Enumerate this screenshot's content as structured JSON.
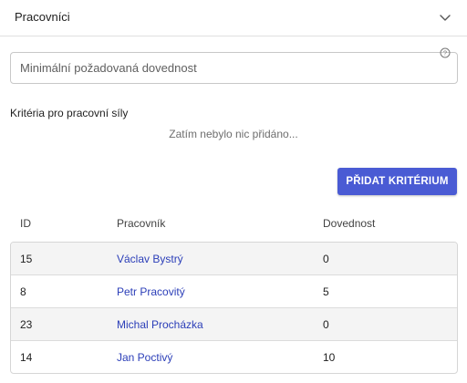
{
  "header": {
    "title": "Pracovníci",
    "toggle_icon": "chevron-down-icon"
  },
  "skill_field": {
    "placeholder": "Minimální požadovaná dovednost",
    "value": "",
    "help_icon": "help-circle-icon"
  },
  "criteria": {
    "label": "Kritéria pro pracovní síly",
    "empty_text": "Zatím nebylo nic přidáno..."
  },
  "add_button": {
    "label": "PŘIDAT KRITÉRIUM",
    "color": "#4a5bd4"
  },
  "table": {
    "columns": [
      "ID",
      "Pracovník",
      "Dovednost"
    ],
    "rows": [
      {
        "id": "15",
        "worker": "Václav Bystrý",
        "skill": "0"
      },
      {
        "id": "8",
        "worker": "Petr Pracovitý",
        "skill": "5"
      },
      {
        "id": "23",
        "worker": "Michal Procházka",
        "skill": "0"
      },
      {
        "id": "14",
        "worker": "Jan Poctivý",
        "skill": "10"
      }
    ],
    "link_color": "#2b3eb8"
  }
}
